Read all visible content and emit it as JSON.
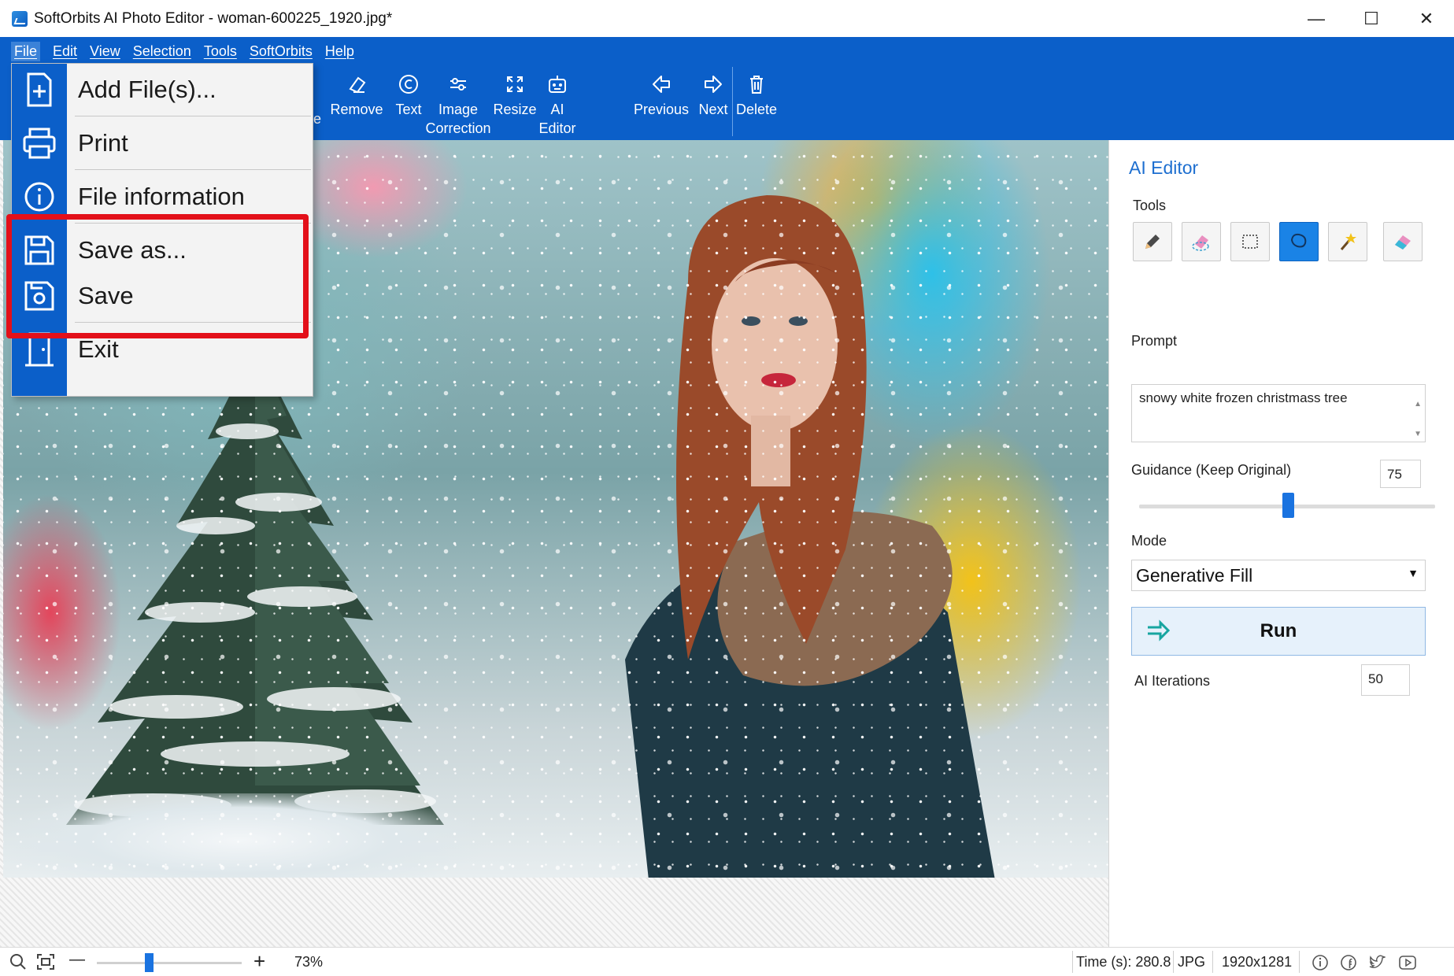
{
  "window": {
    "title": "SoftOrbits AI Photo Editor - woman-600225_1920.jpg*",
    "minimize": "—",
    "maximize": "☐",
    "close": "✕"
  },
  "menubar": {
    "items": [
      "File",
      "Edit",
      "View",
      "Selection",
      "Tools",
      "SoftOrbits",
      "Help"
    ]
  },
  "toolbar": {
    "partial_label": "e",
    "remove": "Remove",
    "text": "Text",
    "image_correction_1": "Image",
    "image_correction_2": "Correction",
    "resize": "Resize",
    "ai_editor_1": "AI",
    "ai_editor_2": "Editor",
    "previous": "Previous",
    "next": "Next",
    "delete": "Delete"
  },
  "file_menu": {
    "items": [
      "Add File(s)...",
      "Print",
      "File information",
      "Save as...",
      "Save",
      "Exit"
    ],
    "highlight_color": "#e3101a"
  },
  "panel": {
    "title": "AI Editor",
    "tools_label": "Tools",
    "tools": [
      "pencil-icon",
      "eraser-brush-icon",
      "rectangle-select-icon",
      "lasso-icon",
      "magic-wand-icon",
      "eraser-icon"
    ],
    "selected_tool": "lasso-icon",
    "prompt_label": "Prompt",
    "prompt_value": "snowy white frozen christmass tree",
    "guidance_label": "Guidance (Keep Original)",
    "guidance_value": "75",
    "mode_label": "Mode",
    "mode_value": "Generative Fill",
    "run_label": "Run",
    "iterations_label": "AI Iterations",
    "iterations_value": "50"
  },
  "statusbar": {
    "zoom_minus": "—",
    "zoom_plus": "+",
    "zoom": "73%",
    "time": "Time (s): 280.8",
    "format": "JPG",
    "dimensions": "1920x1281"
  },
  "colors": {
    "accent": "#0b5fc9",
    "panel_title": "#1e6fd0",
    "selected_tool": "#1a83e6"
  }
}
